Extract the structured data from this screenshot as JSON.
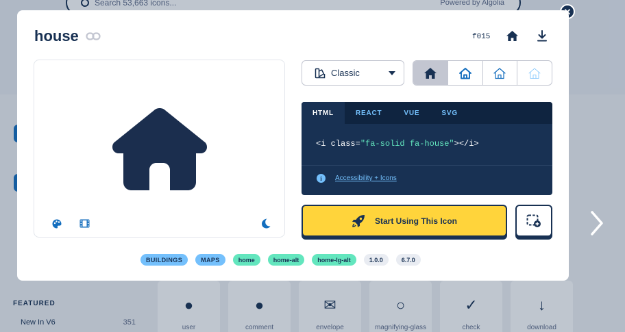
{
  "background": {
    "search_placeholder": "Search 53,663 icons...",
    "powered_by": "Powered by",
    "algolia": "Algolia",
    "featured_heading": "FEATURED",
    "new_in_v6": {
      "label": "New In V6",
      "count": "351"
    },
    "tiles": [
      {
        "label": "user",
        "icon": "user-icon"
      },
      {
        "label": "comment",
        "icon": "comment-icon"
      },
      {
        "label": "envelope",
        "icon": "envelope-icon"
      },
      {
        "label": "magnifying-glass",
        "icon": "magnifying-glass-icon"
      },
      {
        "label": "check",
        "icon": "check-icon"
      },
      {
        "label": "download",
        "icon": "download-icon"
      }
    ]
  },
  "modal": {
    "title": "house",
    "unicode": "f015",
    "style_select": {
      "label": "Classic",
      "icon": "styles-icon"
    },
    "variants": [
      {
        "name": "solid",
        "active": true
      },
      {
        "name": "regular",
        "active": false
      },
      {
        "name": "light",
        "active": false
      },
      {
        "name": "thin",
        "active": false
      }
    ],
    "code": {
      "tabs": [
        "HTML",
        "REACT",
        "VUE",
        "SVG"
      ],
      "active_tab": "HTML",
      "snippet_prefix": "<i class=",
      "snippet_string": "\"fa-solid fa-house\"",
      "snippet_suffix": "></i>",
      "accessibility_link": "Accessibility + Icons"
    },
    "start_button": "Start Using This Icon",
    "tags": {
      "categories": [
        "BUILDINGS",
        "MAPS"
      ],
      "aliases": [
        "home",
        "home-alt",
        "home-lg-alt"
      ],
      "versions": [
        "1.0.0",
        "6.7.0"
      ]
    }
  },
  "colors": {
    "navy": "#183153",
    "yellow": "#ffd43b",
    "blue": "#146ebe",
    "light_blue": "#74c0fc",
    "teal": "#63e6be"
  }
}
